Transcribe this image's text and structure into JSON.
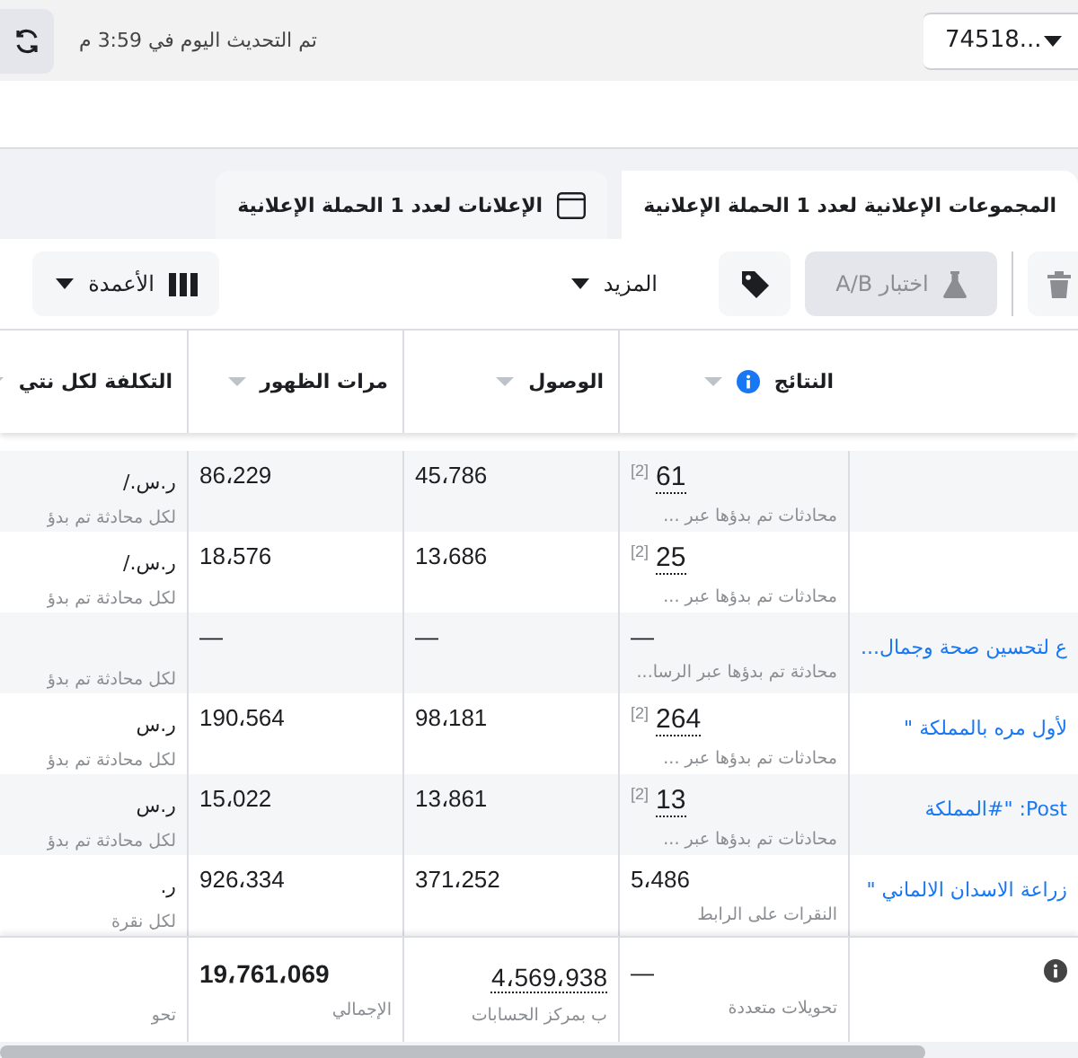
{
  "top_bar": {
    "account_selector": "74518...",
    "update_status": "تم التحديث اليوم في 3:59 م"
  },
  "tabs": [
    {
      "label": "المجموعات الإعلانية لعدد **1** الحملة الإعلانية",
      "selected": true
    },
    {
      "label": "الإعلانات لعدد **1** الحملة الإعلانية",
      "selected": false
    }
  ],
  "toolbar": {
    "ab_test": {
      "label": "اختبار A/B",
      "disabled": true
    },
    "more": "المزيد",
    "columns": "الأعمدة"
  },
  "table": {
    "columns": [
      {
        "label": "النتائج"
      },
      {
        "label": "الوصول"
      },
      {
        "label": "مرات الظهور"
      },
      {
        "label": "التكلفة لكل نتي"
      }
    ],
    "rows": [
      {
        "results": "61",
        "results_note": "[2]",
        "results_sub": "محادثات تم بدؤها عبر ...",
        "reach": "45،786",
        "impressions": "86،229",
        "cost": "ر.س./",
        "cost_sub": "لكل محادثة تم بدؤ"
      },
      {
        "results": "25",
        "results_note": "[2]",
        "results_sub": "محادثات تم بدؤها عبر ...",
        "reach": "13،686",
        "impressions": "18،576",
        "cost": "ر.س./",
        "cost_sub": "لكل محادثة تم بدؤ"
      },
      {
        "name": "ع لتحسين صحة وجمال...",
        "results": "—",
        "results_sub": "محادثة تم بدؤها عبر الرسا...",
        "reach": "—",
        "impressions": "—",
        "cost_sub": "لكل محادثة تم بدؤ"
      },
      {
        "name": "لأول مره بالمملكة \"",
        "results": "264",
        "results_note": "[2]",
        "results_sub": "محادثات تم بدؤها عبر ...",
        "reach": "98،181",
        "impressions": "190،564",
        "cost": "ر.س",
        "cost_sub": "لكل محادثة تم بدؤ"
      },
      {
        "name": "Post: \"#المملكة",
        "results": "13",
        "results_note": "[2]",
        "results_sub": "محادثات تم بدؤها عبر ...",
        "reach": "13،861",
        "impressions": "15،022",
        "cost": "ر.س",
        "cost_sub": "لكل محادثة تم بدؤ"
      },
      {
        "name": "زراعة الاسدان الالماني \"",
        "results": "5،486",
        "results_sub": "النقرات على الرابط",
        "reach": "371،252",
        "impressions": "926،334",
        "cost": "ر.",
        "cost_sub": "لكل نقرة"
      }
    ],
    "totals": {
      "results": "—",
      "results_sub": "تحويلات متعددة",
      "reach": "4،569،938",
      "reach_sub": "ب بمركز الحسابات",
      "impressions": "19،761،069",
      "impressions_sub": "الإجمالي",
      "cost_sub": "تحو"
    }
  }
}
